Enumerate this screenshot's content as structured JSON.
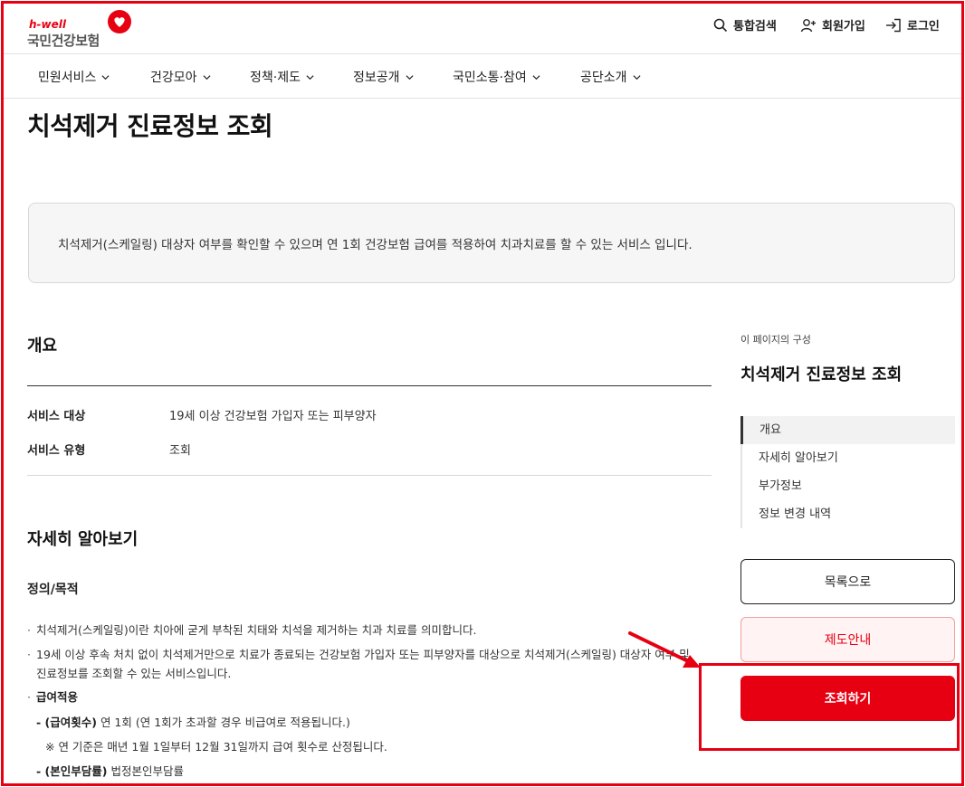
{
  "header": {
    "logo_small": "h-well",
    "logo_name": "국민건강보험",
    "search_label": "통합검색",
    "join_label": "회원가입",
    "login_label": "로그인"
  },
  "nav": {
    "items": [
      {
        "label": "민원서비스"
      },
      {
        "label": "건강모아"
      },
      {
        "label": "정책·제도"
      },
      {
        "label": "정보공개"
      },
      {
        "label": "국민소통·참여"
      },
      {
        "label": "공단소개"
      }
    ]
  },
  "page": {
    "title": "치석제거 진료정보 조회",
    "intro": "치석제거(스케일링) 대상자 여부를 확인할 수 있으며 연 1회 건강보험 급여를 적용하여 치과치료를 할 수 있는 서비스 입니다."
  },
  "overview": {
    "heading": "개요",
    "rows": [
      {
        "label": "서비스 대상",
        "value": "19세 이상 건강보험 가입자 또는 피부양자"
      },
      {
        "label": "서비스 유형",
        "value": "조회"
      }
    ]
  },
  "details": {
    "heading": "자세히 알아보기",
    "sub_heading": "정의/목적",
    "line1": "치석제거(스케일링)이란 치아에 굳게 부착된 치태와 치석을 제거하는 치과 치료를 의미합니다.",
    "line2": "19세 이상 후속 처치 없이 치석제거만으로 치료가 종료되는 건강보험 가입자 또는 피부양자를 대상으로 치석제거(스케일링) 대상자 여부 및",
    "line2b": "진료정보를 조회할 수 있는 서비스입니다.",
    "benefit_heading": "급여적용",
    "count_label": "- (급여횟수)",
    "count_text": "연 1회 (연 1회가 초과할 경우 비급여로 적용됩니다.)",
    "count_note": "※ 연 기준은 매년 1월 1일부터 12월 31일까지 급여 횟수로 산정됩니다.",
    "copay_label": "- (본인부담률)",
    "copay_text": "법정본인부담률"
  },
  "toc": {
    "caption": "이 페이지의 구성",
    "title": "치석제거 진료정보 조회",
    "items": [
      {
        "label": "개요"
      },
      {
        "label": "자세히 알아보기"
      },
      {
        "label": "부가정보"
      },
      {
        "label": "정보 변경 내역"
      }
    ]
  },
  "actions": {
    "list_label": "목록으로",
    "guide_label": "제도안내",
    "query_label": "조회하기"
  },
  "colors": {
    "brand_red": "#e60012",
    "guide_bg": "#fff3f3"
  }
}
